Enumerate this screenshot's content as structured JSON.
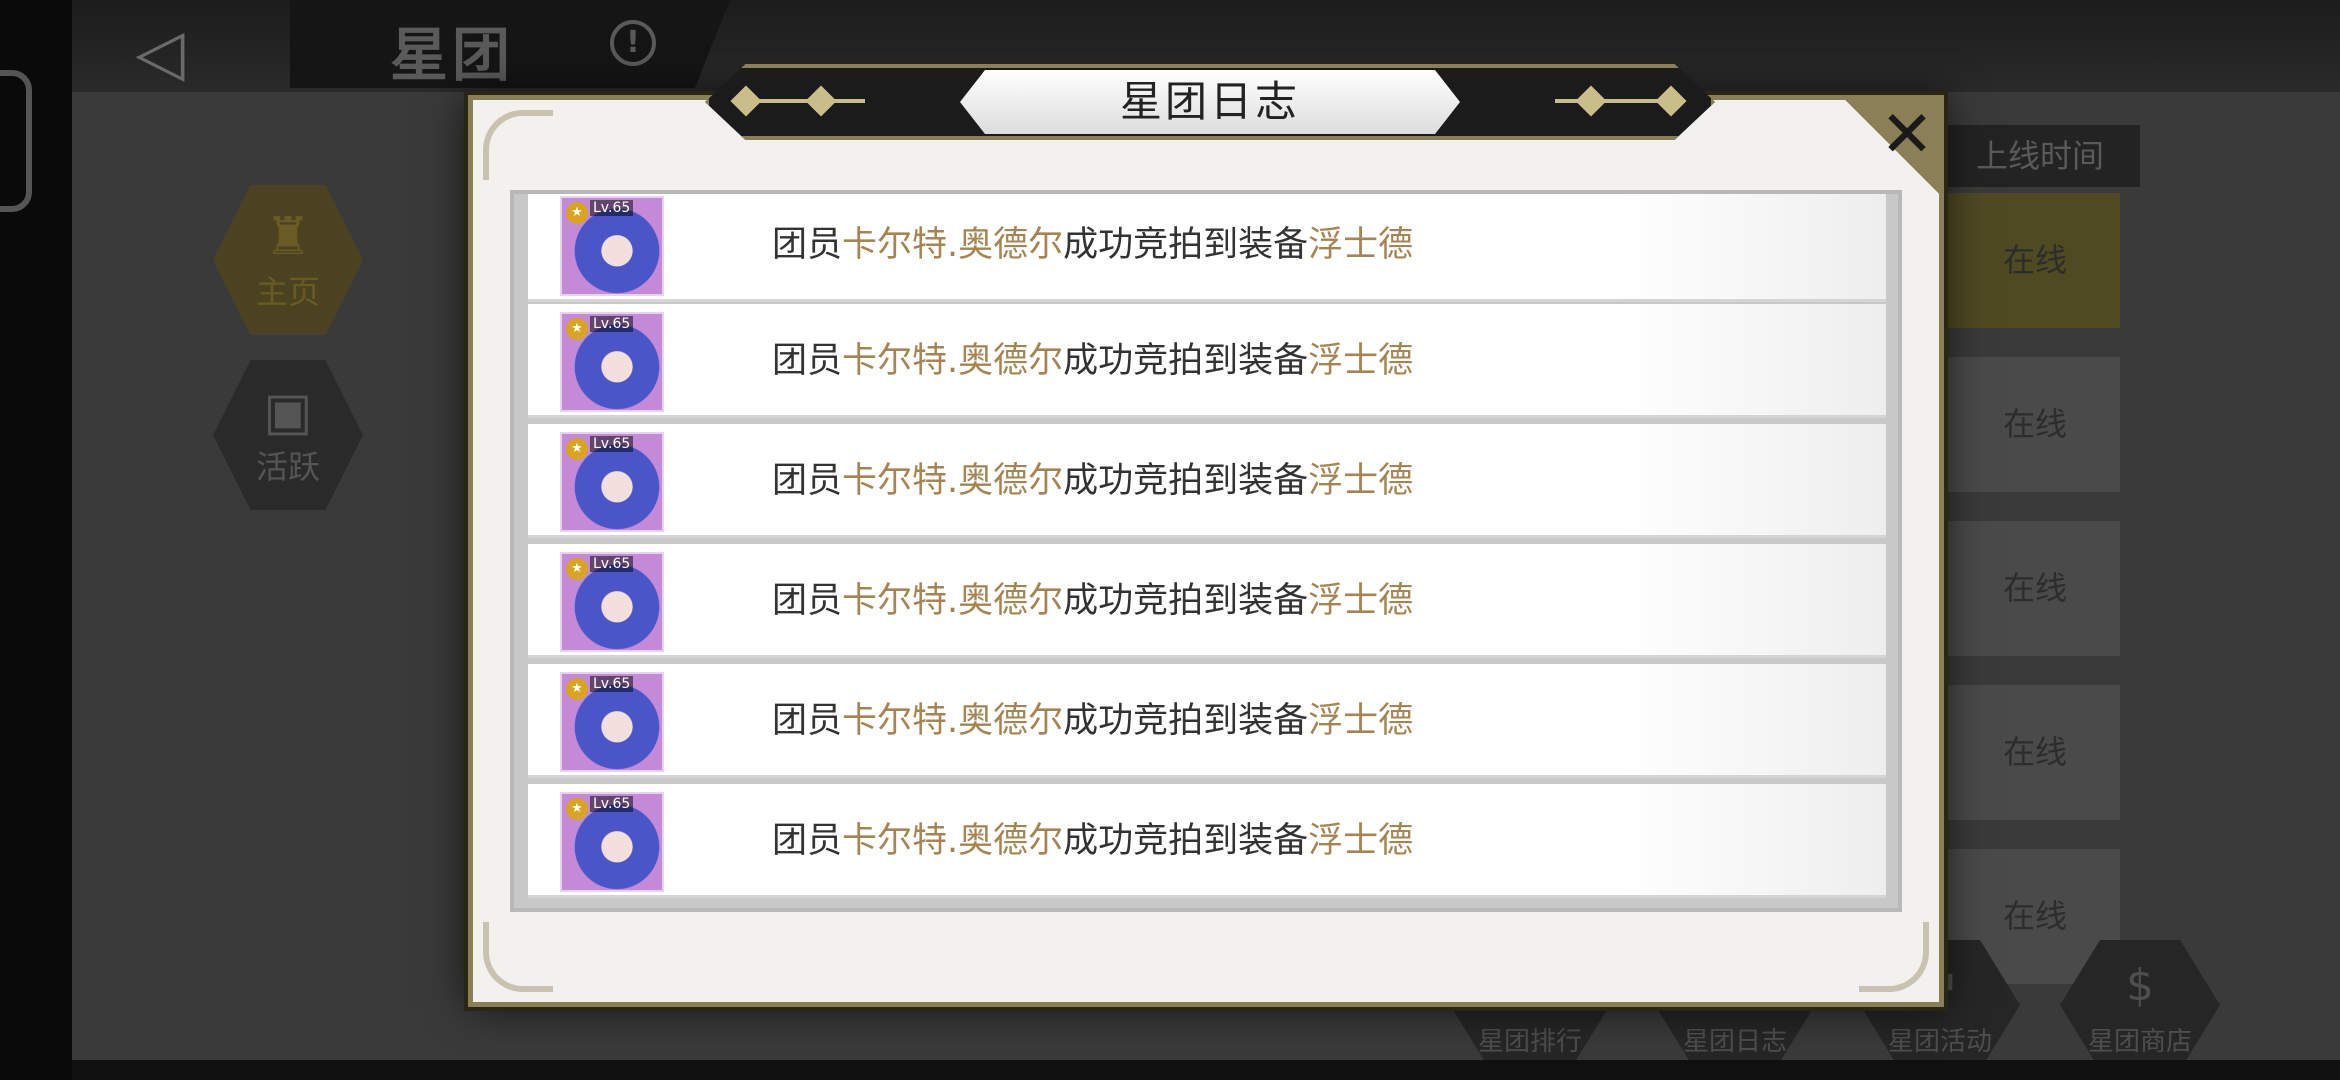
{
  "background": {
    "page_title": "星团",
    "nav": {
      "home_label": "主页",
      "activity_label": "活跃"
    },
    "online_header": "上线时间",
    "online_status": [
      "在线",
      "在线",
      "在线",
      "在线",
      "在线"
    ],
    "bottom_tabs": [
      "星团排行",
      "星团日志",
      "星团活动",
      "星团商店"
    ]
  },
  "modal": {
    "title": "星团日志",
    "close_label": "✕",
    "entries": [
      {
        "prefix": "团员",
        "member": "卡尔特.奥德尔",
        "action": "成功竞拍到装备",
        "item": "浮士德",
        "level": "Lv.65"
      },
      {
        "prefix": "团员",
        "member": "卡尔特.奥德尔",
        "action": "成功竞拍到装备",
        "item": "浮士德",
        "level": "Lv.65"
      },
      {
        "prefix": "团员",
        "member": "卡尔特.奥德尔",
        "action": "成功竞拍到装备",
        "item": "浮士德",
        "level": "Lv.65"
      },
      {
        "prefix": "团员",
        "member": "卡尔特.奥德尔",
        "action": "成功竞拍到装备",
        "item": "浮士德",
        "level": "Lv.65"
      },
      {
        "prefix": "团员",
        "member": "卡尔特.奥德尔",
        "action": "成功竞拍到装备",
        "item": "浮士德",
        "level": "Lv.65"
      },
      {
        "prefix": "团员",
        "member": "卡尔特.奥德尔",
        "action": "成功竞拍到装备",
        "item": "浮士德",
        "level": "Lv.65"
      }
    ]
  },
  "colors": {
    "highlight": "#a68552",
    "frame_gold": "#8b7f55",
    "modal_bg": "#f3f1ee"
  }
}
